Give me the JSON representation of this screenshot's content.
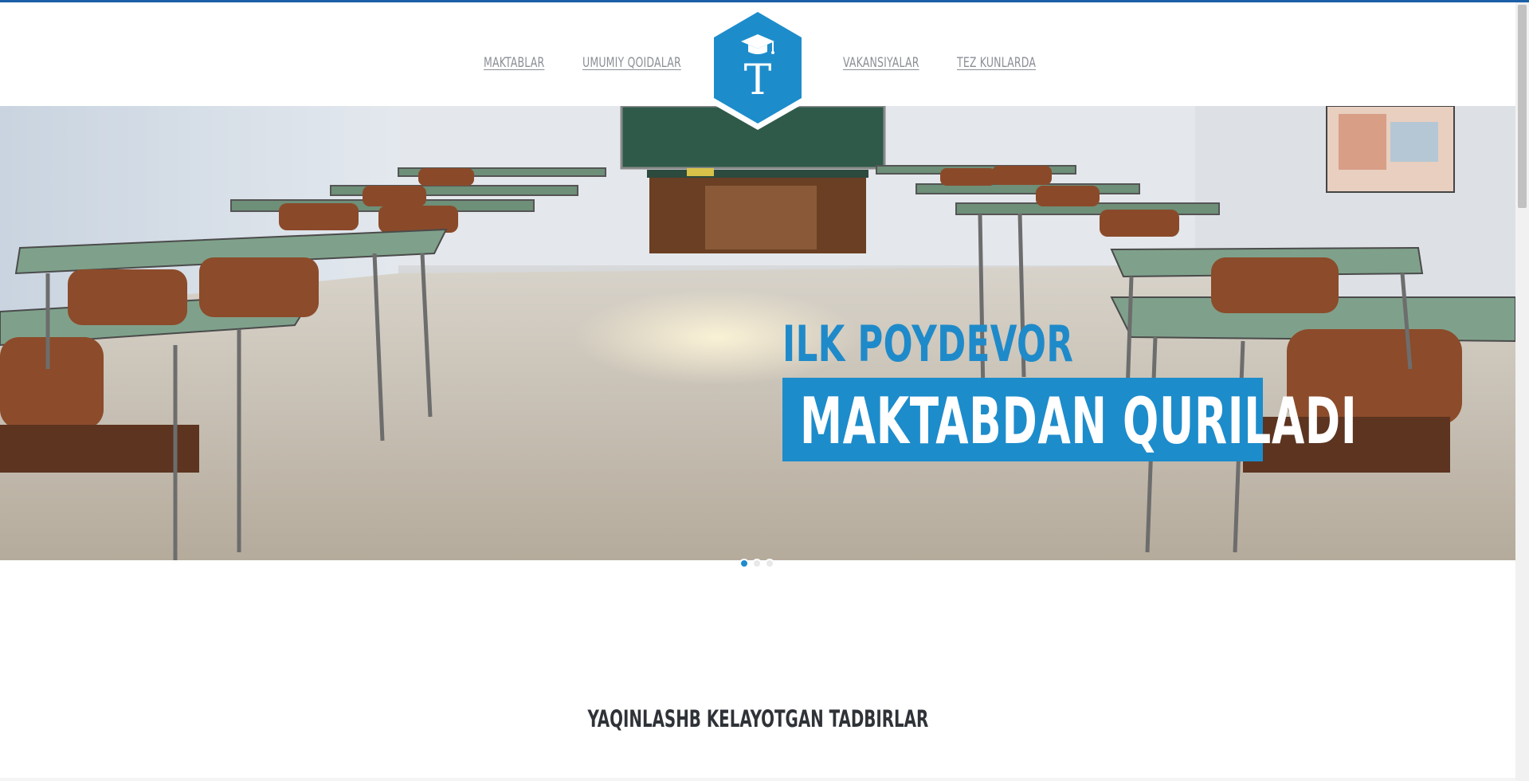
{
  "nav": {
    "items": [
      {
        "label": "MAKTABLAR"
      },
      {
        "label": "UMUMIY QOIDALAR"
      },
      {
        "label": "VAKANSIYALAR"
      },
      {
        "label": "TEZ KUNLARDA"
      }
    ],
    "logo_letter": "T",
    "logo_icon": "graduation-cap-icon"
  },
  "hero": {
    "line1": "ILK POYDEVOR",
    "line2": "MAKTABDAN QURILADI",
    "slides_total": 3,
    "active_slide": 1
  },
  "events": {
    "title": "YAQINLASHB KELAYOTGAN TADBIRLAR"
  },
  "colors": {
    "accent": "#1d8ccb",
    "nav_text": "#8b8f96",
    "top_border": "#1a5fa8"
  }
}
